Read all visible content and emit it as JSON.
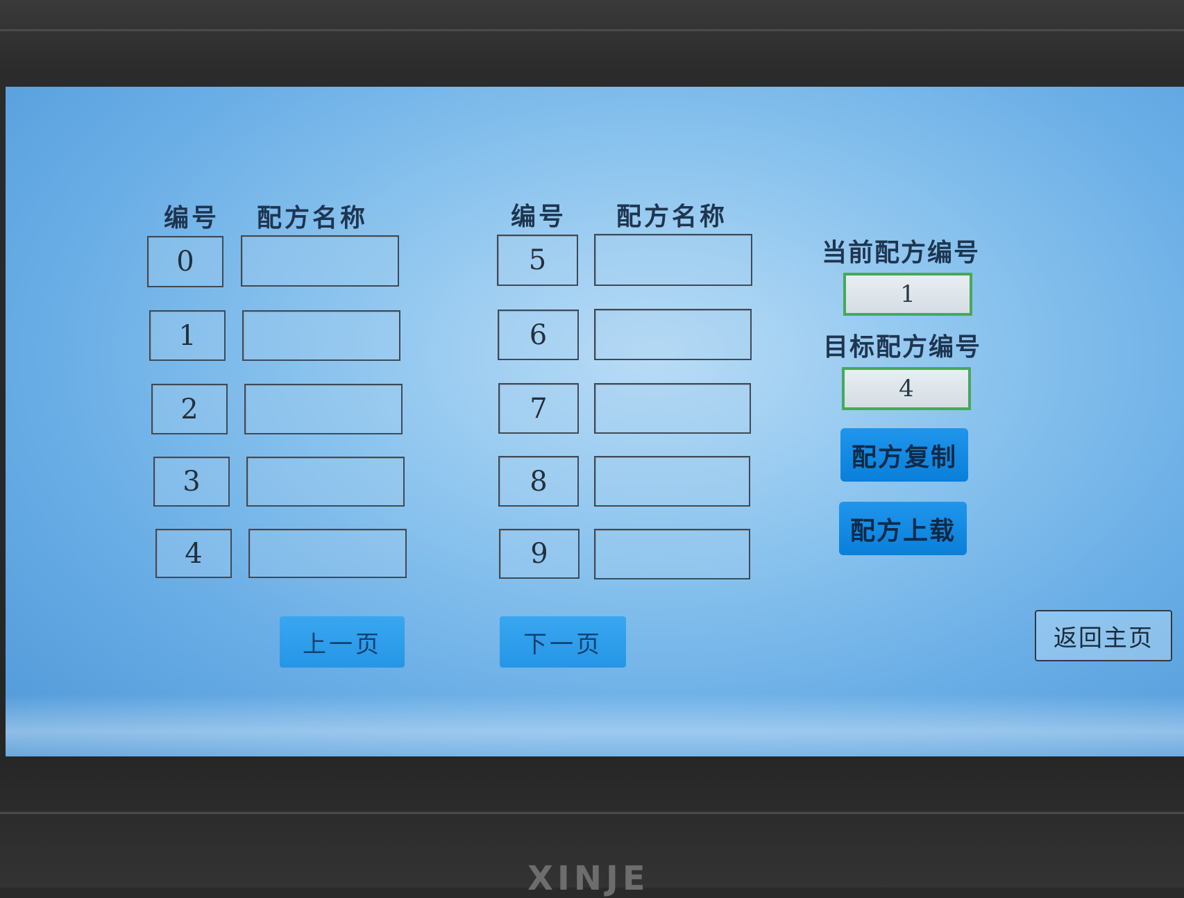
{
  "table_left": {
    "col_number_header": "编号",
    "col_name_header": "配方名称",
    "rows": [
      {
        "number": "0",
        "name": ""
      },
      {
        "number": "1",
        "name": ""
      },
      {
        "number": "2",
        "name": ""
      },
      {
        "number": "3",
        "name": ""
      },
      {
        "number": "4",
        "name": ""
      }
    ]
  },
  "table_right": {
    "col_number_header": "编号",
    "col_name_header": "配方名称",
    "rows": [
      {
        "number": "5",
        "name": ""
      },
      {
        "number": "6",
        "name": ""
      },
      {
        "number": "7",
        "name": ""
      },
      {
        "number": "8",
        "name": ""
      },
      {
        "number": "9",
        "name": ""
      }
    ]
  },
  "side_panel": {
    "current_label": "当前配方编号",
    "current_value": "1",
    "target_label": "目标配方编号",
    "target_value": "4",
    "copy_button": "配方复制",
    "upload_button": "配方上载"
  },
  "pager": {
    "prev_label": "上一页",
    "next_label": "下一页"
  },
  "home_button": "返回主页",
  "brand": "XINJE",
  "colors": {
    "field_border": "#47a85a",
    "button_blue": "#0a7fd9"
  }
}
